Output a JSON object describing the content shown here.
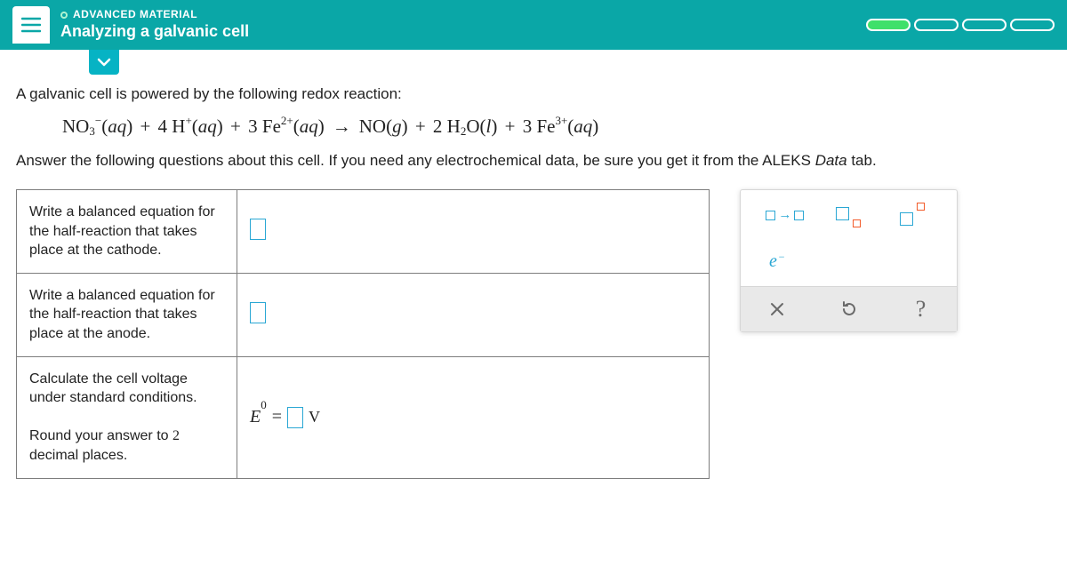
{
  "header": {
    "badge": "ADVANCED MATERIAL",
    "title": "Analyzing a galvanic cell"
  },
  "intro": "A galvanic cell is powered by the following redox reaction:",
  "equation": {
    "lhs": [
      {
        "base": "NO",
        "sub": "3",
        "sup": "−",
        "state": "aq"
      },
      {
        "coef": "4",
        "base": "H",
        "sup": "+",
        "state": "aq"
      },
      {
        "coef": "3",
        "base": "Fe",
        "sup": "2+",
        "state": "aq"
      }
    ],
    "rhs": [
      {
        "base": "NO",
        "state": "g"
      },
      {
        "coef": "2",
        "base": "H",
        "sub": "2",
        "tail": "O",
        "state": "l"
      },
      {
        "coef": "3",
        "base": "Fe",
        "sup": "3+",
        "state": "aq"
      }
    ]
  },
  "instructions_a": "Answer the following questions about this cell. If you need any electrochemical data, be sure you get it from the ALEKS ",
  "instructions_b": "Data",
  "instructions_c": " tab.",
  "questions": {
    "q1": "Write a balanced equation for the half-reaction that takes place at the cathode.",
    "q2": "Write a balanced equation for the half-reaction that takes place at the anode.",
    "q3a": "Calculate the cell voltage under standard conditions.",
    "q3b_prefix": "Round your answer to ",
    "q3b_num": "2",
    "q3b_suffix": " decimal places.",
    "e_symbol": "E",
    "e_sup": "0",
    "equals": "=",
    "unit": "V"
  },
  "palette": {
    "electron": "e"
  }
}
